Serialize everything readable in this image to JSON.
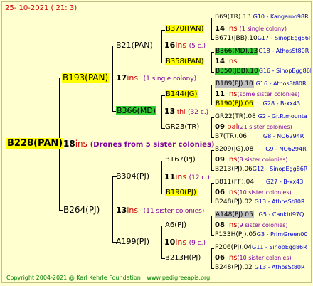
{
  "date": "25- 10-2021 ( 21: 3)",
  "root": {
    "label": "B228(PAN)",
    "num": "18",
    "ins": "ins",
    "note": "(Drones from 5 sister colonies)"
  },
  "gen1": [
    {
      "label": "B193(PAN)",
      "num": "17",
      "ins": "ins",
      "note": "(1 single colony)"
    },
    {
      "label": "B264(PJ)",
      "num": "13",
      "ins": "ins",
      "note": "(11 sister colonies)"
    }
  ],
  "gen2": [
    {
      "label": "B21(PAN)",
      "num": "16",
      "ins": "ins",
      "note": "(5 c.)"
    },
    {
      "label": "B366(MD)",
      "num": "13",
      "ins": "lthl",
      "note": "(32 c.)"
    },
    {
      "label": "B304(PJ)",
      "num": "11",
      "ins": "ins",
      "note": "(12 c.)"
    },
    {
      "label": "A199(PJ)",
      "num": "10",
      "ins": "ins",
      "note": "(9 c.)"
    }
  ],
  "gen3": [
    {
      "label": "B370(PAN)",
      "num": "14",
      "ins": "ins",
      "note": "(1 single colony)"
    },
    {
      "label": "B358(PAN)",
      "num": "14",
      "ins": "ins",
      "note": ""
    },
    {
      "label": "B144(JG)",
      "num": "11",
      "ins": "ins",
      "note": "(some sister colonies)"
    },
    {
      "label": "GR23(TR)",
      "num": "09",
      "ins": "bal",
      "note": "(21 sister colonies)"
    },
    {
      "label": "B167(PJ)",
      "num": "09",
      "ins": "ins",
      "note": "(8 sister colonies)"
    },
    {
      "label": "B190(PJ)",
      "num": "06",
      "ins": "ins",
      "note": "(10 sister colonies)"
    },
    {
      "label": "A6(PJ)",
      "num": "08",
      "ins": "ins",
      "note": "(9 sister colonies)"
    },
    {
      "label": "B213H(PJ)",
      "num": "06",
      "ins": "ins",
      "note": "(10 sister colonies)"
    }
  ],
  "gen4": [
    {
      "label": "B69(TR).13",
      "loc": "G10 - Kangaroo98R"
    },
    {
      "label": "B671(JBB).10",
      "loc": "G17 - SinopEgg86R"
    },
    {
      "label": "B366(MD).13",
      "loc": "G18 - AthosSt80R"
    },
    {
      "label": "B350(JBB).10",
      "loc": "G16 - SinopEgg86R"
    },
    {
      "label": "B189(PJ).10",
      "loc": "G16 - AthosSt80R"
    },
    {
      "label": "B190(PJ).06",
      "loc": "G28 - B-xx43"
    },
    {
      "label": "GR22(TR).08",
      "loc": "G2 - Gr.R.mounta"
    },
    {
      "label": "B7(TR).06",
      "loc": "G8 - NO6294R"
    },
    {
      "label": "B209(JG).08",
      "loc": "G9 - NO6294R"
    },
    {
      "label": "B213(PJ).06",
      "loc": "G12 - SinopEgg86R"
    },
    {
      "label": "B811(FF).04",
      "loc": "G27 - B-xx43"
    },
    {
      "label": "B248(PJ).02",
      "loc": "G13 - AthosSt80R"
    },
    {
      "label": "A148(PJ).05",
      "loc": "G5 - Cankiri97Q"
    },
    {
      "label": "P133H(PJ).05",
      "loc": "G3 - PrimGreen00"
    },
    {
      "label": "P206(PJ).04",
      "loc": "G11 - SinopEgg86R"
    },
    {
      "label": "B248(PJ).02",
      "loc": "G13 - AthosSt80R"
    }
  ],
  "footer": {
    "copyright": "Copyright 2004-2021 @ Karl Kehrle Foundation",
    "url": "www.pedigreeapis.org"
  },
  "colors": {
    "background": "#ffffd0",
    "highlight_yellow": "#ffff00",
    "highlight_green": "#33cc33",
    "ins_red": "#cc0000",
    "note_purple": "#8000a0",
    "loc_blue": "#0000cc",
    "footer_green": "#008000"
  }
}
